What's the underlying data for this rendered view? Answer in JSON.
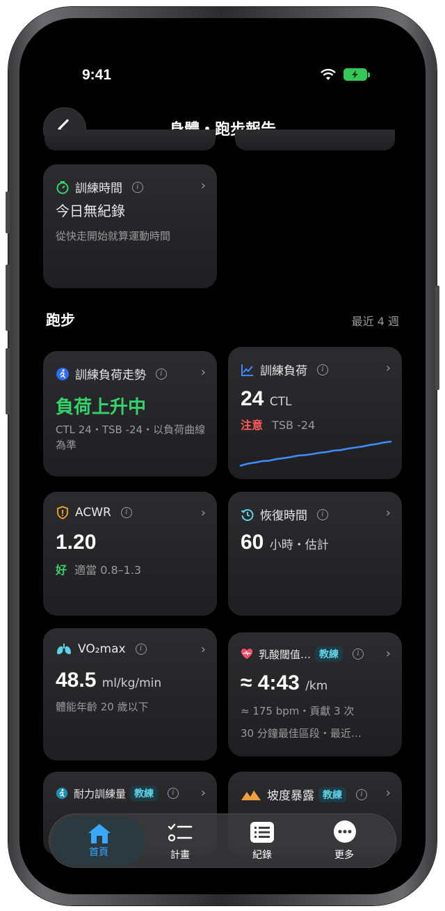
{
  "status": {
    "time": "9:41"
  },
  "nav": {
    "title": "身體・跑步報告"
  },
  "training_time_card": {
    "title": "訓練時間",
    "value": "今日無紀錄",
    "note": "從快走開始就算運動時間"
  },
  "running_section": {
    "title": "跑步",
    "range": "最近 4 週"
  },
  "load_trend_card": {
    "title": "訓練負荷走勢",
    "value": "負荷上升中",
    "note": "CTL 24・TSB -24・以負荷曲線為準",
    "value_color": "#34d36b"
  },
  "training_load_card": {
    "title": "訓練負荷",
    "value": "24",
    "unit": "CTL",
    "status": "注意",
    "status_color": "#ff5a5a",
    "detail": "TSB -24"
  },
  "training_load_chart": {
    "chart_data": {
      "type": "line",
      "values": [
        0.04,
        0.12,
        0.16,
        0.22,
        0.24,
        0.3,
        0.34,
        0.38,
        0.44,
        0.46,
        0.5,
        0.55,
        0.58,
        0.64,
        0.66,
        0.72,
        0.76,
        0.8,
        0.86,
        0.9,
        0.96,
        1.0
      ],
      "color": "#3d8bff"
    }
  },
  "acwr_card": {
    "title": "ACWR",
    "value": "1.20",
    "status": "好",
    "status_color": "#34d36b",
    "detail": "適當 0.8–1.3"
  },
  "recovery_card": {
    "title": "恢復時間",
    "value": "60",
    "unit": "小時・估計"
  },
  "vo2_card": {
    "title": "VO₂max",
    "value": "48.5",
    "unit": "ml/kg/min",
    "note": "體能年齡 20 歲以下"
  },
  "lactate_card": {
    "title": "乳酸閾值…",
    "badge": "教練",
    "value": "≈ 4:43",
    "unit": "/km",
    "line1": "≈ 175 bpm・貢獻 3 次",
    "line2": "30 分鐘最佳區段・最近…"
  },
  "endurance_card": {
    "title": "耐力訓練量",
    "badge": "教練"
  },
  "slope_card": {
    "title": "坡度暴露",
    "badge": "教練"
  },
  "tabbar": {
    "home": "首頁",
    "plan": "計畫",
    "log": "紀錄",
    "more": "更多"
  },
  "colors": {
    "accent": "#3aa7ff",
    "green": "#34d36b",
    "coach": "#5ed2e6"
  }
}
